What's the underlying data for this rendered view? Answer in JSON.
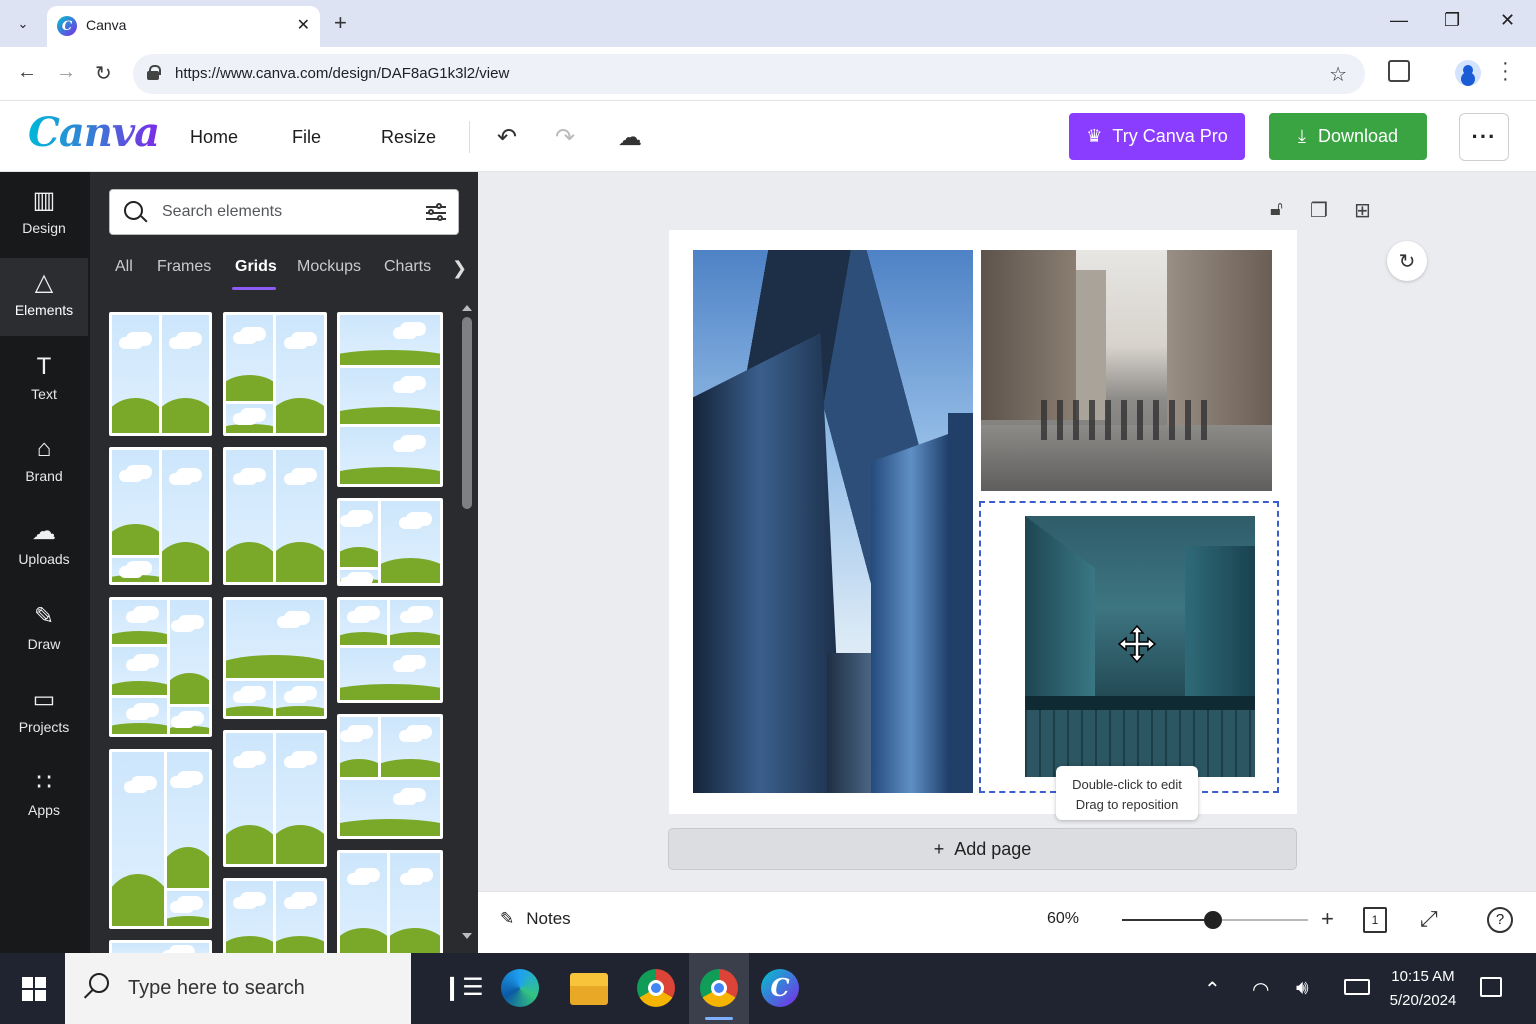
{
  "browser": {
    "tab_title": "Canva",
    "url": "https://www.canva.com/design/DAF8aG1k3l2/view"
  },
  "header": {
    "logo": "Canva",
    "menu": [
      "Home",
      "File",
      "Resize"
    ],
    "try_pro_label": "Try Canva Pro",
    "download_label": "Download",
    "brand_colors": {
      "pro": "#8b3dff",
      "download": "#3aa443"
    }
  },
  "rail": {
    "items": [
      {
        "label": "Design",
        "icon": "layout-icon"
      },
      {
        "label": "Elements",
        "icon": "shapes-icon"
      },
      {
        "label": "Text",
        "icon": "text-icon"
      },
      {
        "label": "Brand",
        "icon": "brand-icon"
      },
      {
        "label": "Uploads",
        "icon": "cloud-upload-icon"
      },
      {
        "label": "Draw",
        "icon": "pen-icon"
      },
      {
        "label": "Projects",
        "icon": "folder-icon"
      },
      {
        "label": "Apps",
        "icon": "grid-icon"
      }
    ],
    "active": "Elements"
  },
  "panel": {
    "search_placeholder": "Search elements",
    "categories": [
      "All",
      "Frames",
      "Grids",
      "Mockups",
      "Charts"
    ],
    "active_category": "Grids"
  },
  "canvas": {
    "tooltip_line1": "Double-click to edit",
    "tooltip_line2": "Drag to reposition",
    "add_page_label": "Add page"
  },
  "footer": {
    "notes_label": "Notes",
    "zoom": "60%",
    "zoom_fraction": 0.49,
    "page_count": "1"
  },
  "taskbar": {
    "search_placeholder": "Type here to search",
    "time": "10:15 AM",
    "date": "5/20/2024"
  }
}
